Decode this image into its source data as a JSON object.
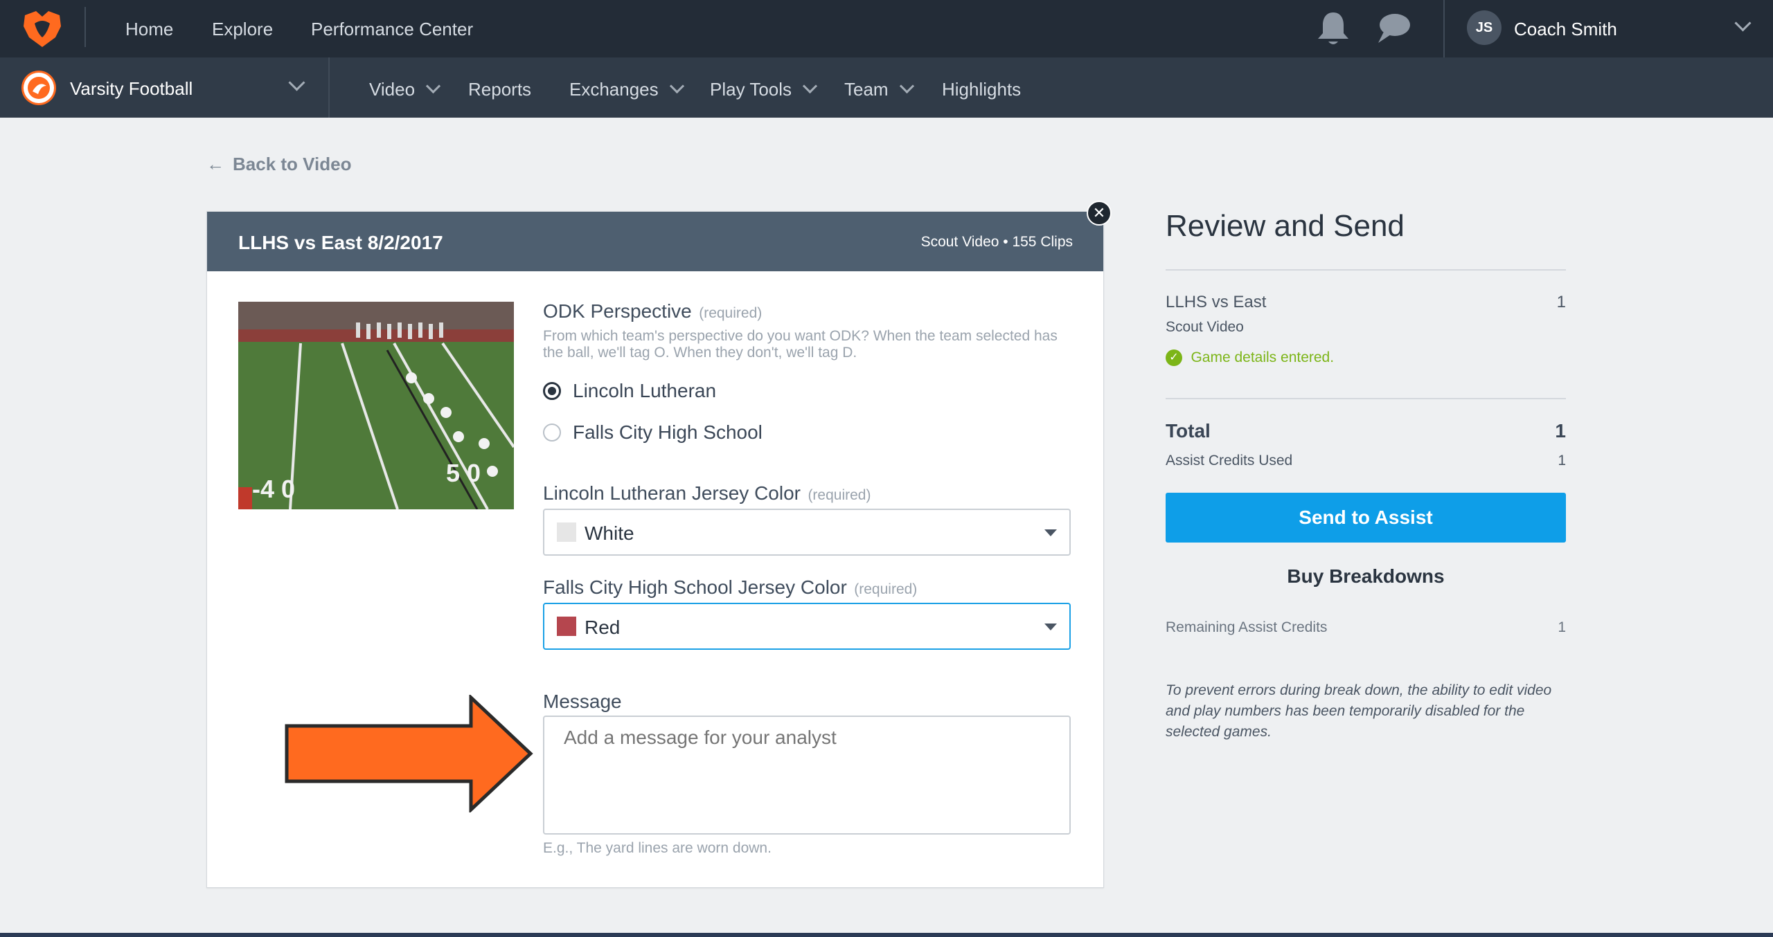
{
  "topnav": {
    "items": [
      "Home",
      "Explore",
      "Performance Center"
    ],
    "user_initials": "JS",
    "user_name": "Coach Smith"
  },
  "subnav": {
    "team": "Varsity Football",
    "items": [
      {
        "label": "Video",
        "dropdown": true
      },
      {
        "label": "Reports",
        "dropdown": false
      },
      {
        "label": "Exchanges",
        "dropdown": true
      },
      {
        "label": "Play Tools",
        "dropdown": true
      },
      {
        "label": "Team",
        "dropdown": true
      },
      {
        "label": "Highlights",
        "dropdown": false
      }
    ]
  },
  "back_link": "Back to Video",
  "card": {
    "title": "LLHS vs East 8/2/2017",
    "meta": "Scout Video • 155 Clips",
    "odk": {
      "label": "ODK Perspective",
      "required": "(required)",
      "help": "From which team's perspective do you want ODK? When the team selected has the ball, we'll tag O. When they don't, we'll tag D.",
      "options": [
        "Lincoln Lutheran",
        "Falls City High School"
      ],
      "selected": "Lincoln Lutheran"
    },
    "jersey1": {
      "label": "Lincoln Lutheran Jersey Color",
      "required": "(required)",
      "value": "White",
      "swatch": "#e6e6e6"
    },
    "jersey2": {
      "label": "Falls City High School Jersey Color",
      "required": "(required)",
      "value": "Red",
      "swatch": "#b5464e"
    },
    "message": {
      "label": "Message",
      "placeholder": "Add a message for your analyst",
      "hint": "E.g., The yard lines are worn down."
    }
  },
  "review": {
    "title": "Review and Send",
    "game_name": "LLHS vs East",
    "game_count": "1",
    "game_type": "Scout Video",
    "status": "Game details entered.",
    "total_label": "Total",
    "total_value": "1",
    "credits_used_label": "Assist Credits Used",
    "credits_used_value": "1",
    "send_button": "Send to Assist",
    "buy_link": "Buy Breakdowns",
    "remaining_label": "Remaining Assist Credits",
    "remaining_value": "1",
    "note": "To prevent errors during break down, the ability to edit video and play numbers has been temporarily disabled for the selected games."
  },
  "colors": {
    "brand_orange": "#ff6a1f",
    "send_blue": "#0e9ee8",
    "success_green": "#7cb518",
    "focus_blue": "#1aa0e6"
  }
}
